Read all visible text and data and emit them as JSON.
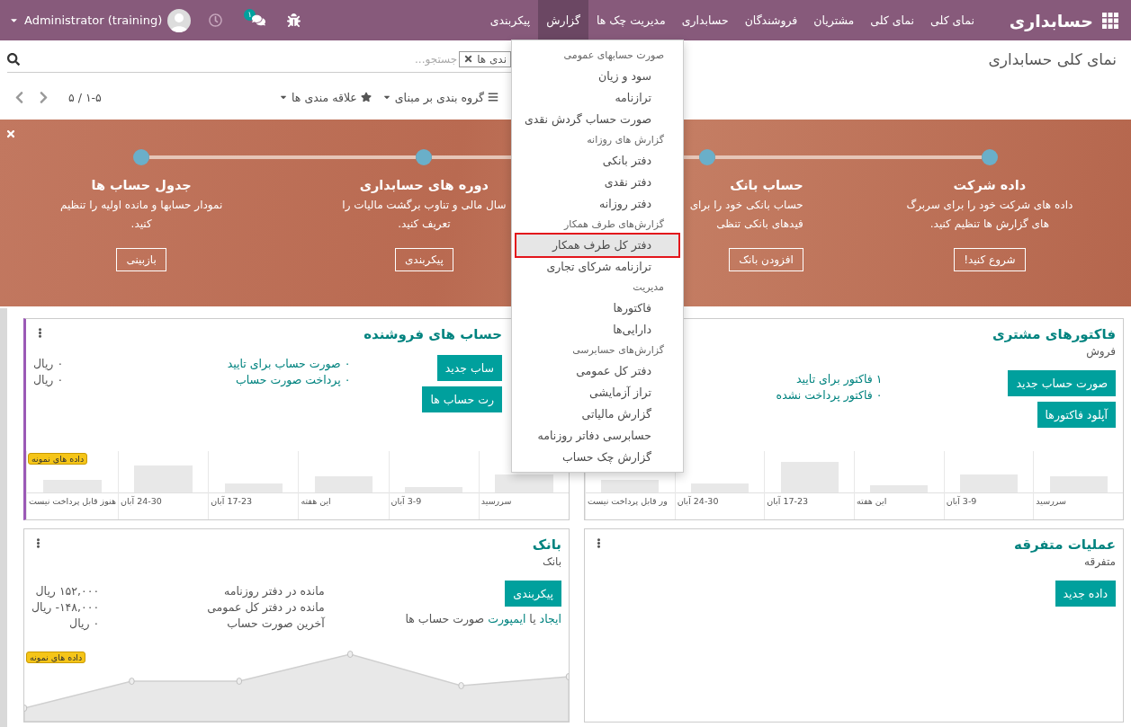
{
  "navbar": {
    "brand": "حسابداری",
    "menu": [
      {
        "label": "نمای کلی",
        "selected": false
      },
      {
        "label": "نمای کلی",
        "selected": false
      },
      {
        "label": "مشتریان",
        "selected": false
      },
      {
        "label": "فروشندگان",
        "selected": false
      },
      {
        "label": "حسابداری",
        "selected": false
      },
      {
        "label": "مدیریت چک ها",
        "selected": false
      },
      {
        "label": "گزارش",
        "selected": true
      },
      {
        "label": "پیکربندی",
        "selected": false
      }
    ],
    "chat_count": "۱",
    "user": "Administrator (training)"
  },
  "control_panel": {
    "breadcrumb": "نمای کلی حسابداری",
    "search": {
      "facet": "ندی ها",
      "placeholder": "جستجو..."
    },
    "group_by": "گروه بندی بر مبنای",
    "favorites": "علاقه مندی ها",
    "pager": "۱-۵ / ۵"
  },
  "onboarding": {
    "steps": [
      {
        "title": "داده شرکت",
        "lines": [
          "داده های شرکت خود را برای سربرگ",
          "های گزارش ها تنظیم کنید."
        ],
        "button": "شروع کنید!"
      },
      {
        "title": "حساب بانک",
        "lines": [
          "حساب بانکی خود را برای",
          "فیدهای بانکی تنظی"
        ],
        "button": "افزودن بانک"
      },
      {
        "title": "دوره های حسابداری",
        "lines": [
          "سال مالی و تناوب برگشت مالیات را",
          "تعریف کنید."
        ],
        "button": "پیکربندی"
      },
      {
        "title": "جدول حساب ها",
        "lines": [
          "نمودار حسابها و مانده اولیه را تنظیم",
          "کنید."
        ],
        "button": "بازبینی"
      }
    ]
  },
  "dashboard": [
    {
      "kind": "bars",
      "title": "فاکتورهای مشتری",
      "subtitle": "فروش",
      "buttons": [
        "صورت حساب جدید",
        "آپلود فاکتورها"
      ],
      "links": [
        "۱ فاکتور برای تایید",
        "۰ فاکتور پرداخت نشده"
      ],
      "labels": [
        "سررسید",
        "3-9 آبان",
        "این هفته",
        "17-23 آبان",
        "24-30 آبان",
        "ور قابل پرداخت نیست"
      ]
    },
    {
      "kind": "bars",
      "options": true,
      "title": "حساب های فروشنده",
      "buttons": [
        "ساب جدید",
        "رت حساب ها"
      ],
      "links": [
        "۰ صورت حساب برای تایید",
        "۰ پرداخت صورت حساب"
      ],
      "values": [
        "۰ ریال",
        "۰ ریال"
      ],
      "badge": "داده های نمونه",
      "labels": [
        "سررسید",
        "3-9 آبان",
        "این هفته",
        "17-23 آبان",
        "24-30 آبان",
        "هنوز قابل پرداخت نیست"
      ]
    },
    {
      "kind": "plain",
      "options": true,
      "title": "عملیات متفرقه",
      "subtitle": "متفرقه",
      "buttons": [
        "داده جدید"
      ]
    },
    {
      "kind": "line",
      "options": true,
      "title": "بانک",
      "subtitle": "بانک",
      "buttons": [
        "پیکربندی"
      ],
      "sentence": {
        "link_1": "ایجاد",
        "middle": "یا",
        "link_2": "ایمپورت",
        "rest": "صورت حساب ها"
      },
      "stats": [
        {
          "label": "مانده در دفتر روزنامه",
          "value": "۱۵۲,۰۰۰ ریال"
        },
        {
          "label": "مانده در دفتر کل عمومی",
          "value": "۱۴۸,۰۰۰- ریال"
        },
        {
          "label": "آخرین صورت حساب",
          "value": "۰ ریال"
        }
      ],
      "badge": "داده های نمونه"
    }
  ],
  "reports_menu": [
    {
      "kind": "header",
      "label": "صورت حسابهای عمومی"
    },
    {
      "kind": "item",
      "label": "سود و زیان",
      "selected": false
    },
    {
      "kind": "item",
      "label": "ترازنامه",
      "selected": false
    },
    {
      "kind": "item",
      "label": "صورت حساب گردش نقدی",
      "selected": false
    },
    {
      "kind": "header",
      "label": "گزارش های روزانه"
    },
    {
      "kind": "item",
      "label": "دفتر بانکی",
      "selected": false
    },
    {
      "kind": "item",
      "label": "دفتر نقدی",
      "selected": false
    },
    {
      "kind": "item",
      "label": "دفتر روزانه",
      "selected": false
    },
    {
      "kind": "header",
      "label": "گزارش‌های طرف همکار"
    },
    {
      "kind": "item",
      "label": "دفتر کل طرف همکار",
      "selected": true
    },
    {
      "kind": "item",
      "label": "ترازنامه شرکای تجاری",
      "selected": false
    },
    {
      "kind": "header",
      "label": "مدیریت"
    },
    {
      "kind": "item",
      "label": "فاکتورها",
      "selected": false
    },
    {
      "kind": "item",
      "label": "دارایی‌ها",
      "selected": false
    },
    {
      "kind": "header",
      "label": "گزارش‌های حسابرسی"
    },
    {
      "kind": "item",
      "label": "دفتر کل عمومی",
      "selected": false
    },
    {
      "kind": "item",
      "label": "تراز آزمایشی",
      "selected": false
    },
    {
      "kind": "item",
      "label": "گزارش مالیاتی",
      "selected": false
    },
    {
      "kind": "item",
      "label": "حسابرسی دفاتر روزنامه",
      "selected": false
    },
    {
      "kind": "item",
      "label": "گزارش چک حساب",
      "selected": false
    }
  ]
}
